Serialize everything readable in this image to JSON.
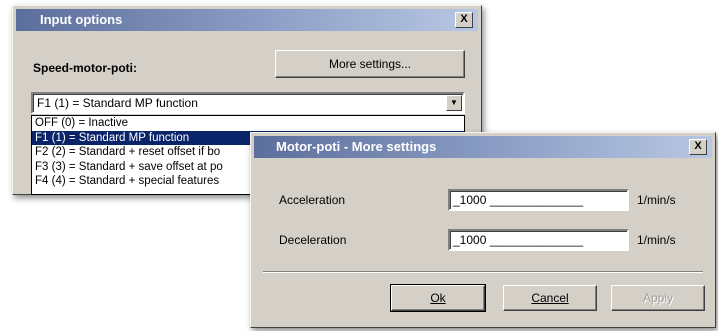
{
  "input_options_dialog": {
    "title": "Input options",
    "close_label": "X",
    "speed_label": "Speed-motor-poti:",
    "more_settings_button": "More settings...",
    "combo_value": "F1 (1) = Standard MP function",
    "list_items": [
      "OFF (0) = Inactive",
      "F1 (1) = Standard MP function",
      "F2 (2) = Standard + reset offset if bo",
      "F3 (3) = Standard + save offset at po",
      "F4 (4) = Standard + special features"
    ],
    "selected_index": 1
  },
  "more_settings_dialog": {
    "title": "Motor-poti - More settings",
    "close_label": "X",
    "acceleration": {
      "label": "Acceleration",
      "value": "_1000 ______________",
      "unit": "1/min/s"
    },
    "deceleration": {
      "label": "Deceleration",
      "value": "_1000 ______________",
      "unit": "1/min/s"
    },
    "ok_button": "Ok",
    "cancel_button": "Cancel",
    "apply_button": "Apply"
  }
}
